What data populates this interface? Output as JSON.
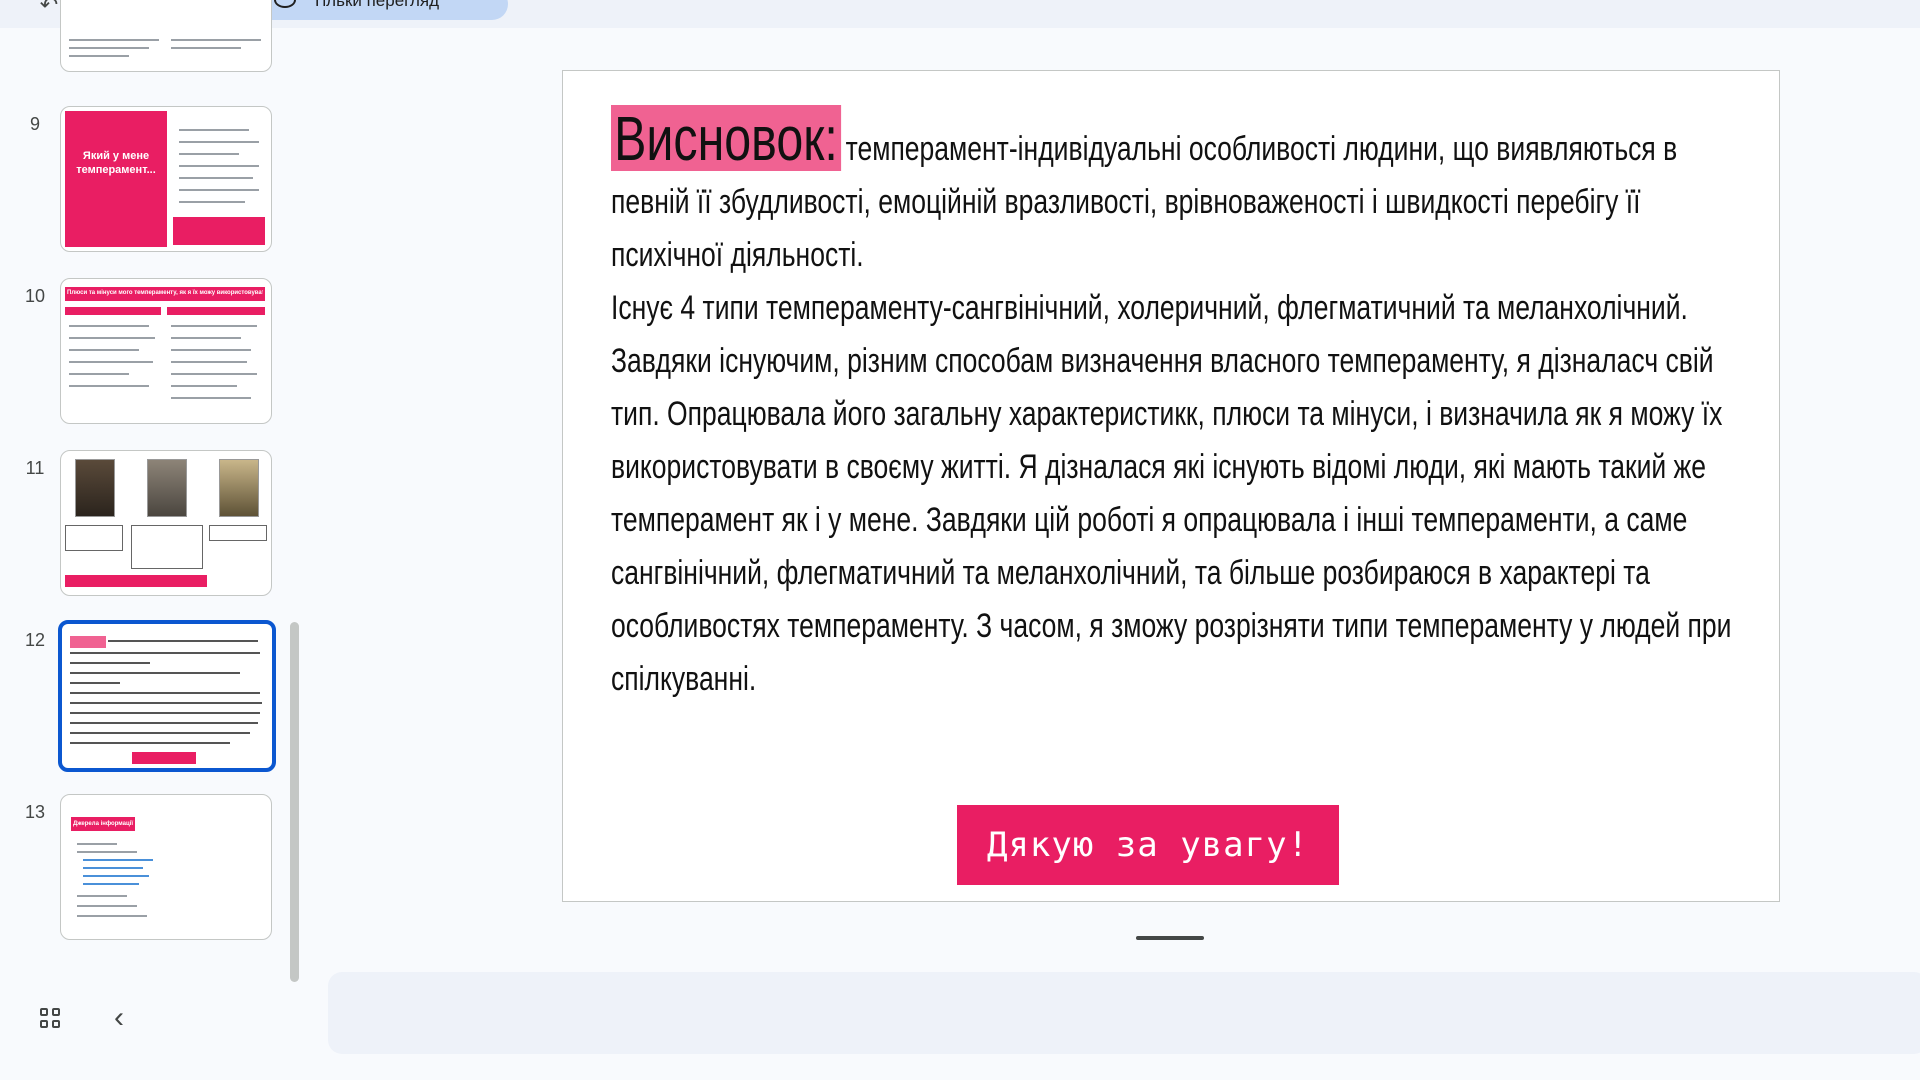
{
  "toolbar": {
    "mode_label": "Тільки перегляд"
  },
  "filmstrip": {
    "slides": [
      {
        "number": "9"
      },
      {
        "number": "10"
      },
      {
        "number": "11"
      },
      {
        "number": "12",
        "selected": true
      },
      {
        "number": "13"
      }
    ],
    "thumb9_title": "Який у мене темперамент...",
    "thumb10_header": "Плюси та мінуси мого темпераменту, як я їх можу використовувати",
    "thumb13_header": "Джерела інформації"
  },
  "slide": {
    "heading": "Висновок:",
    "para1_rest": "темперамент-індивідуальні особливості людини, що виявляються в певній її збудливості, емоційній вразливості, врівноваженості і швидкості перебігу її психічної діяльності.",
    "para2": "Існує 4 типи темпераменту-сангвінічний, холеричний, флегматичний та меланхолічний.",
    "para3": "Завдяки існуючим, різним способам визначення власного темпераменту, я дізналасч свій тип. Опрацювала його загальну характеристикк, плюси та мінуси, і визначила як я можу їх використовувати в своєму житті. Я дізналася які існують відомі люди, які мають такий же темперамент як і у мене. Завдяки цій роботі я опрацювала і інші темпераменти, а саме сангвінічний, флегматичний та меланхолічний, та більше розбираюся в характері та особливостях темпераменту. З часом, я зможу розрізняти типи темпераменту у людей при спілкуванні.",
    "thanks_label": "Дякую за увагу!"
  },
  "colors": {
    "accent_pink": "#e91e63",
    "highlight_pink": "#f06292",
    "selection_blue": "#0b57d0"
  }
}
